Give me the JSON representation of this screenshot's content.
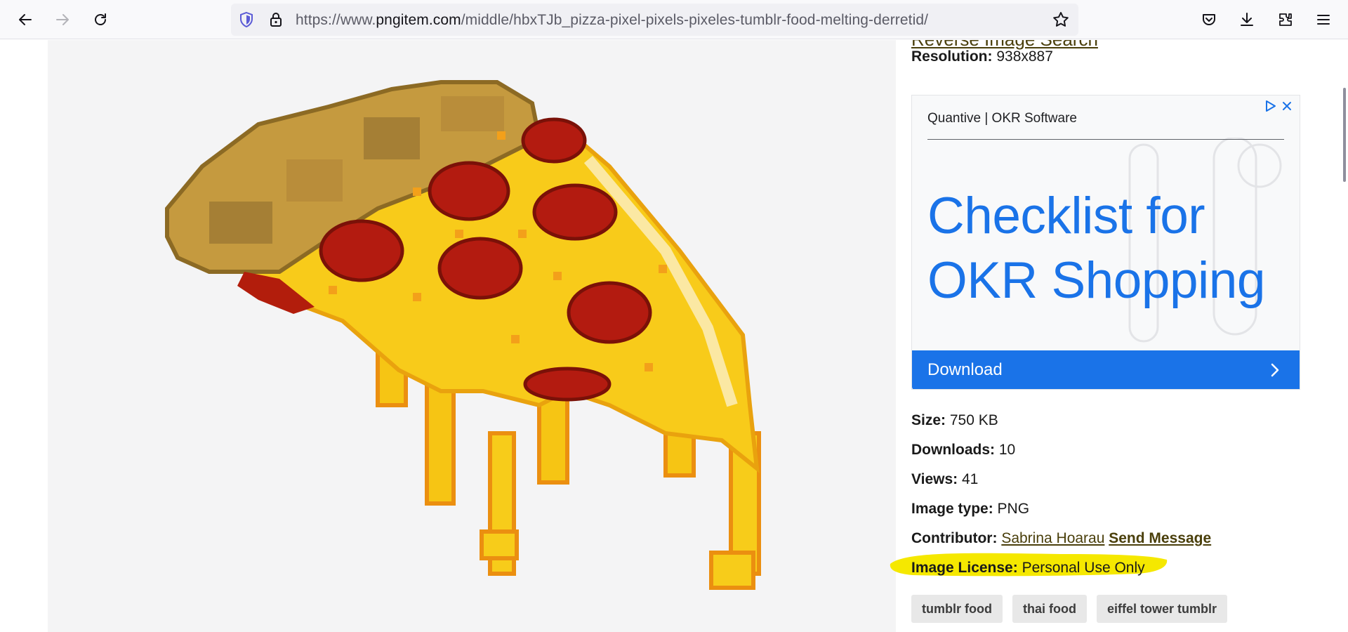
{
  "browser": {
    "url_prefix": "https://www.",
    "url_domain": "pngitem.com",
    "url_path": "/middle/hbxTJb_pizza-pixel-pixels-pixeles-tumblr-food-melting-derretid/",
    "icons": {
      "back": "arrow-left-icon",
      "forward": "arrow-right-icon",
      "reload": "reload-icon",
      "shield": "tracking-shield-icon",
      "lock": "lock-icon",
      "bookmark": "star-icon",
      "pocket": "pocket-icon",
      "downloads": "download-icon",
      "extensions": "extensions-icon",
      "menu": "hamburger-menu-icon"
    }
  },
  "image": {
    "subject": "melting pixel pizza slice"
  },
  "details": {
    "reverse_search_link": "Reverse Image Search",
    "resolution_label": "Resolution:",
    "resolution_value": "938x887",
    "size_label": "Size:",
    "size_value": "750 KB",
    "downloads_label": "Downloads:",
    "downloads_value": "10",
    "views_label": "Views:",
    "views_value": "41",
    "type_label": "Image type:",
    "type_value": "PNG",
    "contributor_label": "Contributor:",
    "contributor_name": "Sabrina Hoarau",
    "send_message": "Send Message",
    "license_label": "Image License:",
    "license_value": "Personal Use Only",
    "highlight_color": "#f5e800"
  },
  "ad": {
    "advertiser": "Quantive | OKR Software",
    "headline": "Checklist for OKR Shopping",
    "cta_label": "Download",
    "accent_color": "#1a73e8"
  },
  "tags": [
    "tumblr food",
    "thai food",
    "eiffel tower tumblr"
  ]
}
